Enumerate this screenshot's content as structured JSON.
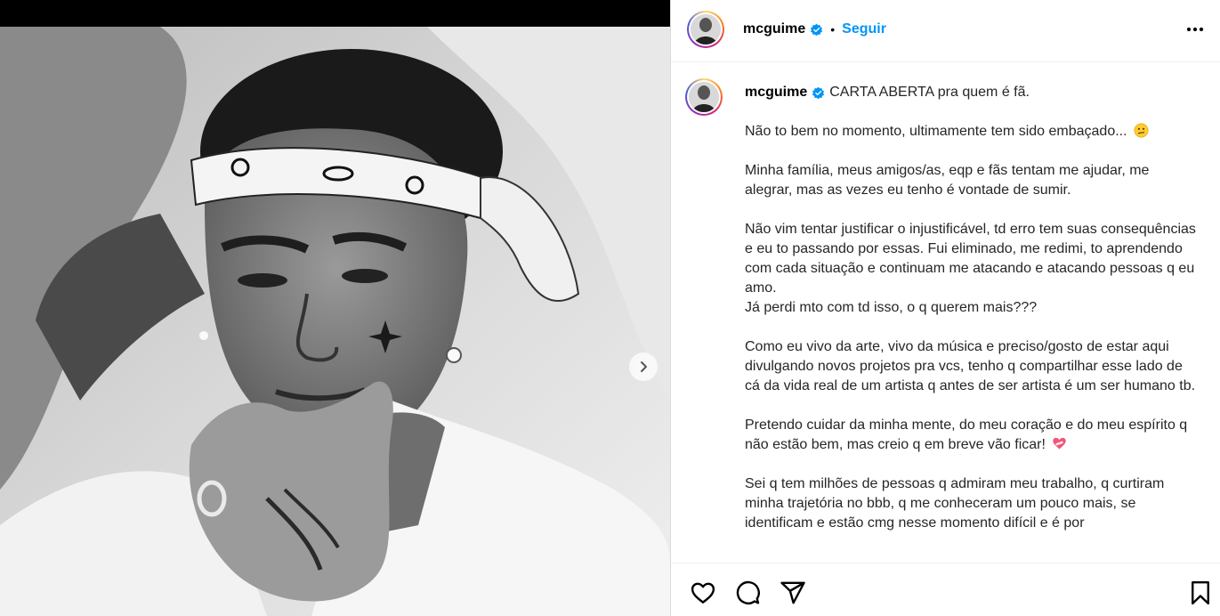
{
  "post": {
    "username": "mcguime",
    "follow_label": "Seguir",
    "separator": "•",
    "more_label": "Mais opções"
  },
  "caption": {
    "username": "mcguime",
    "paragraphs": [
      "CARTA ABERTA pra quem é fã.",
      "Não to bem no momento, ultimamente tem sido embaçado...",
      "Minha família, meus amigos/as, eqp e fãs tentam me ajudar, me alegrar, mas as vezes eu tenho é vontade de sumir.",
      "Não vim tentar justificar o injustificável, td erro tem suas consequências e eu to passando por essas. Fui eliminado, me redimi, to aprendendo com cada situação e continuam me atacando e atacando pessoas q eu amo.",
      "Já perdi mto com td isso, o q querem mais???",
      "Como eu vivo da arte, vivo da música e preciso/gosto de estar aqui divulgando novos projetos pra vcs, tenho q compartilhar esse lado de cá da vida real de um artista q antes de ser artista é um ser humano tb.",
      "Pretendo cuidar da minha mente, do meu coração e do meu espírito q não estão bem, mas creio q em breve vão ficar!",
      "Sei q tem milhões de pessoas q admiram meu trabalho, q curtiram minha trajetória no bbb, q me conheceram um pouco mais, se identificam e estão cmg nesse momento difícil e é por"
    ]
  },
  "icons": {
    "verified": "verified-badge-icon",
    "more": "more-horizontal-icon",
    "next": "chevron-right-icon",
    "like": "heart-icon",
    "comment": "comment-icon",
    "share": "paper-plane-icon",
    "save": "bookmark-icon",
    "emoji_worried": "confused-face-emoji",
    "emoji_heart": "mending-heart-emoji"
  },
  "colors": {
    "accent": "#0095f6",
    "verified": "#0095f6",
    "text": "#262626",
    "border": "#dbdbdb"
  }
}
